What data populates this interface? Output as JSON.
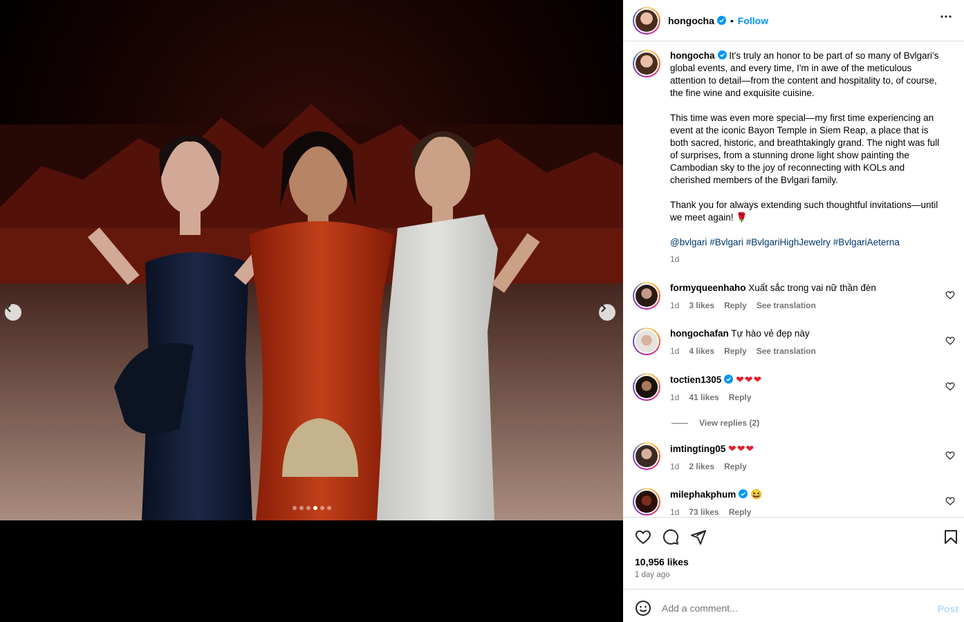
{
  "post": {
    "username": "hongocha",
    "follow_label": "Follow",
    "separator": "•",
    "caption_paragraphs": [
      "It's truly an honor to be part of so many of Bvlgari's global events, and every time, I'm in awe of the meticulous attention to detail—from the content and hospitality to, of course, the fine wine and exquisite cuisine.",
      "This time was even more special—my first time experiencing an event at the iconic Bayon Temple in Siem Reap, a place that is both sacred, historic, and breathtakingly grand. The night was full of surprises, from a stunning drone light show painting the Cambodian sky to the joy of reconnecting with KOLs and cherished members of the Bvlgari family.",
      "Thank you for always extending such thoughtful invitations—until we meet again! 🌹"
    ],
    "hashtags": "@bvlgari #Bvlgari #BvlgariHighJewelry #BvlgariAeterna",
    "caption_time": "1d"
  },
  "carousel": {
    "dot_count": 6,
    "active_dot": 3
  },
  "comments": [
    {
      "username": "formyqueenhaho",
      "verified": false,
      "text": "Xuất sắc trong vai nữ thần đèn",
      "time": "1d",
      "likes": "3 likes",
      "reply": "Reply",
      "translate": "See translation"
    },
    {
      "username": "hongochafan",
      "verified": false,
      "text": "Tự hào vẻ đẹp này",
      "time": "1d",
      "likes": "4 likes",
      "reply": "Reply",
      "translate": "See translation"
    },
    {
      "username": "toctien1305",
      "verified": true,
      "text": "❤❤❤",
      "time": "1d",
      "likes": "41 likes",
      "reply": "Reply",
      "translate": ""
    },
    {
      "username": "imtingting05",
      "verified": false,
      "text": "❤❤❤",
      "time": "1d",
      "likes": "2 likes",
      "reply": "Reply",
      "translate": ""
    },
    {
      "username": "milephakphum",
      "verified": true,
      "text": "😆",
      "time": "1d",
      "likes": "73 likes",
      "reply": "Reply",
      "translate": ""
    }
  ],
  "view_replies": "View replies (2)",
  "footer": {
    "likes": "10,956 likes",
    "time_ago": "1 day ago",
    "comment_placeholder": "Add a comment...",
    "post_label": "Post"
  },
  "colors": {
    "accent": "#0095f6",
    "hashtag": "#00376b",
    "muted": "#737373",
    "border": "#dbdbdb"
  }
}
